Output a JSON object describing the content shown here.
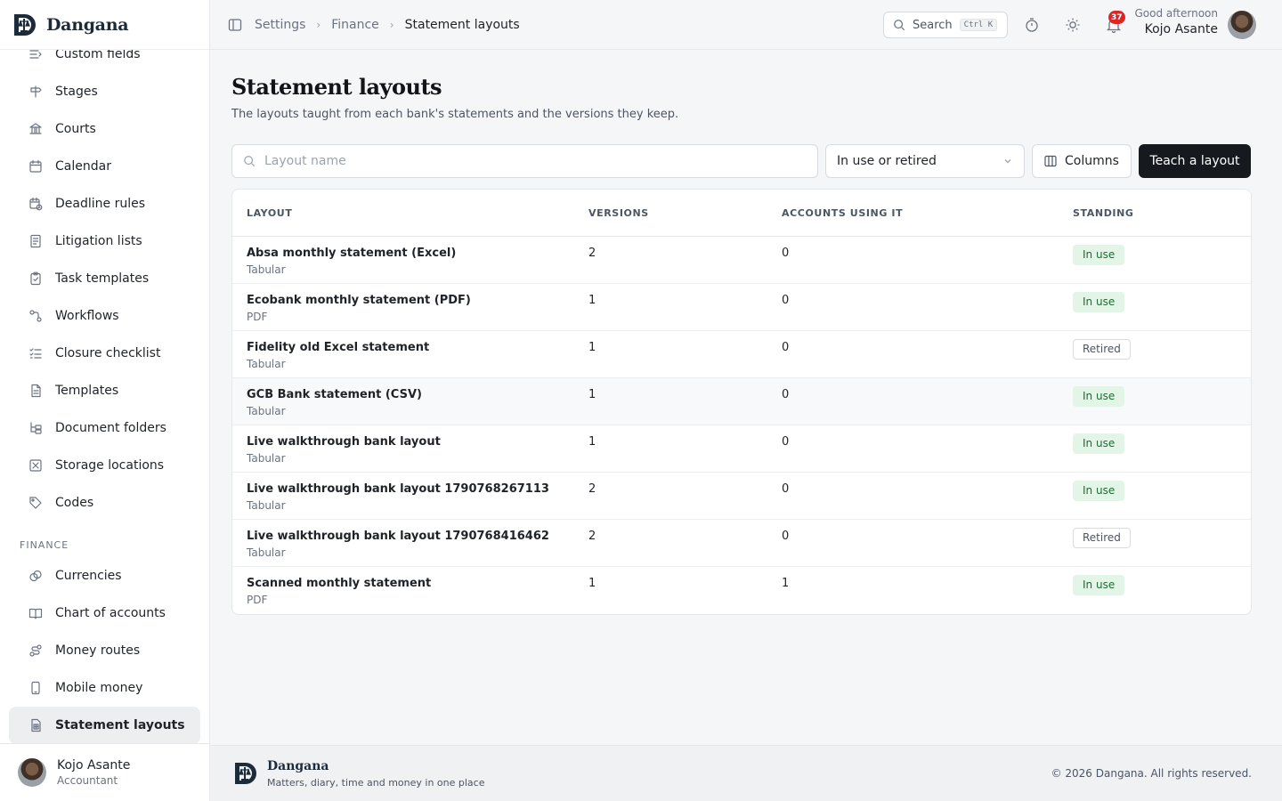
{
  "app": {
    "name": "Dangana",
    "tagline": "Matters, diary, time and money in one place",
    "copyright": "© 2026 Dangana. All rights reserved."
  },
  "sidebar": {
    "items_top": [
      {
        "label": "Custom fields",
        "icon": "custom-fields-icon"
      },
      {
        "label": "Stages",
        "icon": "signpost-icon"
      },
      {
        "label": "Courts",
        "icon": "courthouse-icon"
      },
      {
        "label": "Calendar",
        "icon": "calendar-icon"
      },
      {
        "label": "Deadline rules",
        "icon": "calendar-clock-icon"
      },
      {
        "label": "Litigation lists",
        "icon": "list-book-icon"
      },
      {
        "label": "Task templates",
        "icon": "clipboard-icon"
      },
      {
        "label": "Workflows",
        "icon": "workflow-icon"
      },
      {
        "label": "Closure checklist",
        "icon": "checklist-icon"
      },
      {
        "label": "Templates",
        "icon": "file-template-icon"
      },
      {
        "label": "Document folders",
        "icon": "folder-tree-icon"
      },
      {
        "label": "Storage locations",
        "icon": "archive-box-icon"
      },
      {
        "label": "Codes",
        "icon": "tag-icon"
      }
    ],
    "finance_section_label": "FINANCE",
    "items_finance": [
      {
        "label": "Currencies",
        "icon": "coins-icon"
      },
      {
        "label": "Chart of accounts",
        "icon": "book-open-icon"
      },
      {
        "label": "Money routes",
        "icon": "route-icon"
      },
      {
        "label": "Mobile money",
        "icon": "smartphone-icon"
      },
      {
        "label": "Statement layouts",
        "icon": "file-spreadsheet-icon",
        "active": true
      }
    ],
    "user": {
      "name": "Kojo Asante",
      "role": "Accountant"
    }
  },
  "topbar": {
    "breadcrumbs": [
      "Settings",
      "Finance",
      "Statement layouts"
    ],
    "search_label": "Search",
    "search_shortcut": "Ctrl K",
    "notification_count": "37",
    "greeting": "Good afternoon",
    "user_name": "Kojo Asante"
  },
  "page": {
    "title": "Statement layouts",
    "subtitle": "The layouts taught from each bank's statements and the versions they keep.",
    "filter_placeholder": "Layout name",
    "status_filter": "In use or retired",
    "columns_button": "Columns",
    "primary_button": "Teach a layout"
  },
  "table": {
    "headers": [
      "LAYOUT",
      "VERSIONS",
      "ACCOUNTS USING IT",
      "STANDING"
    ],
    "rows": [
      {
        "name": "Absa monthly statement (Excel)",
        "kind": "Tabular",
        "versions": "2",
        "accounts": "0",
        "standing": "In use"
      },
      {
        "name": "Ecobank monthly statement (PDF)",
        "kind": "PDF",
        "versions": "1",
        "accounts": "0",
        "standing": "In use"
      },
      {
        "name": "Fidelity old Excel statement",
        "kind": "Tabular",
        "versions": "1",
        "accounts": "0",
        "standing": "Retired"
      },
      {
        "name": "GCB Bank statement (CSV)",
        "kind": "Tabular",
        "versions": "1",
        "accounts": "0",
        "standing": "In use"
      },
      {
        "name": "Live walkthrough bank layout",
        "kind": "Tabular",
        "versions": "1",
        "accounts": "0",
        "standing": "In use"
      },
      {
        "name": "Live walkthrough bank layout 1790768267113",
        "kind": "Tabular",
        "versions": "2",
        "accounts": "0",
        "standing": "In use"
      },
      {
        "name": "Live walkthrough bank layout 1790768416462",
        "kind": "Tabular",
        "versions": "2",
        "accounts": "0",
        "standing": "Retired"
      },
      {
        "name": "Scanned monthly statement",
        "kind": "PDF",
        "versions": "1",
        "accounts": "1",
        "standing": "In use"
      }
    ]
  },
  "colors": {
    "primary_button": "#16191d",
    "in_use_bg": "#e3f5e6",
    "in_use_text": "#1f6b34",
    "badge": "#dc2626"
  }
}
